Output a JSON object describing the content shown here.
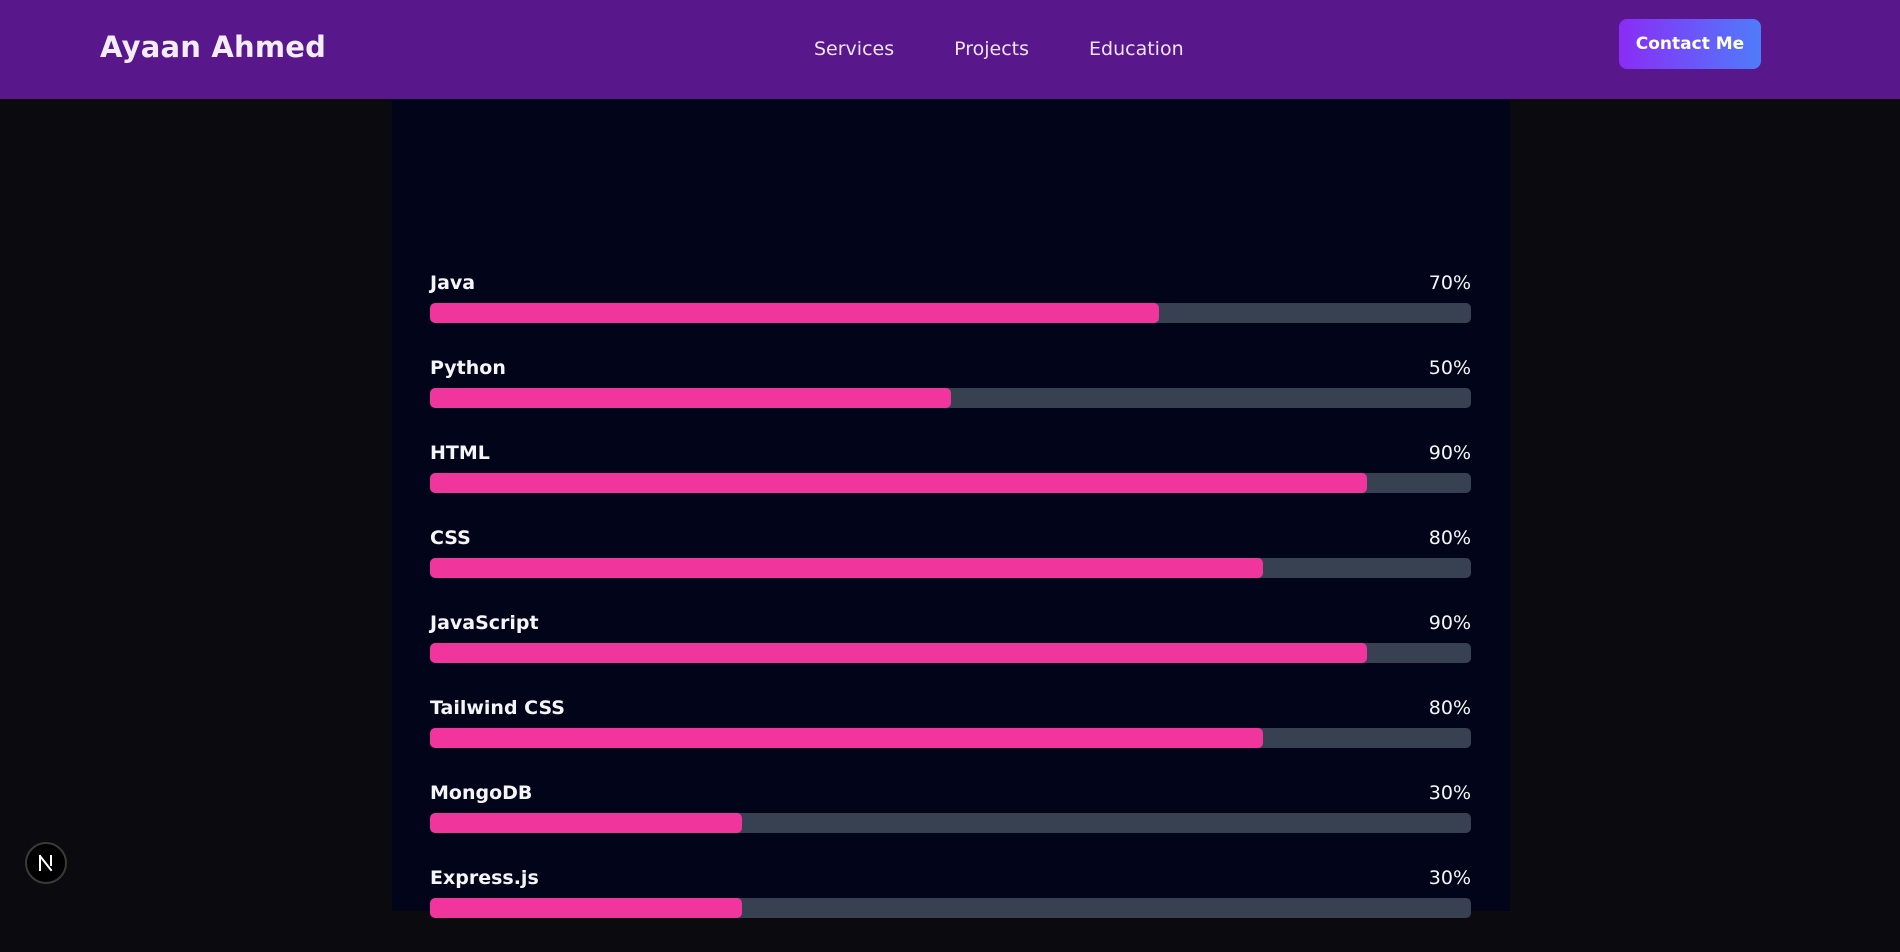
{
  "header": {
    "brand": "Ayaan Ahmed",
    "nav": [
      {
        "label": "Services"
      },
      {
        "label": "Projects"
      },
      {
        "label": "Education"
      }
    ],
    "contact_label": "Contact Me"
  },
  "skills": [
    {
      "name": "Java",
      "percent_label": "70%",
      "level": 70
    },
    {
      "name": "Python",
      "percent_label": "50%",
      "level": 50
    },
    {
      "name": "HTML",
      "percent_label": "90%",
      "level": 90
    },
    {
      "name": "CSS",
      "percent_label": "80%",
      "level": 80
    },
    {
      "name": "JavaScript",
      "percent_label": "90%",
      "level": 90
    },
    {
      "name": "Tailwind CSS",
      "percent_label": "80%",
      "level": 80
    },
    {
      "name": "MongoDB",
      "percent_label": "30%",
      "level": 30
    },
    {
      "name": "Express.js",
      "percent_label": "30%",
      "level": 30
    }
  ],
  "colors": {
    "navbar": "#58178a",
    "panel": "#02051a",
    "bar_fill": "#f0359c",
    "bar_track": "#374151",
    "button_gradient_start": "#8a2cf5",
    "button_gradient_end": "#4f7cfa"
  },
  "icons": {
    "dev_badge": "nextjs-n-icon"
  }
}
